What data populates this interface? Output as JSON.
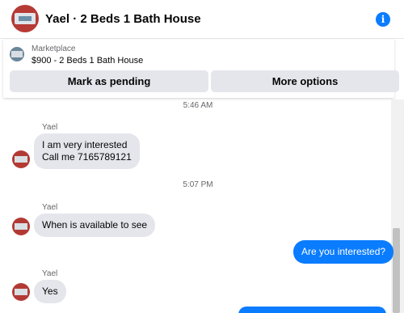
{
  "header": {
    "title": "Yael · 2 Beds 1 Bath House",
    "info_icon": "i"
  },
  "listing": {
    "kicker": "Marketplace",
    "title": "$900 - 2 Beds 1 Bath House",
    "buttons": {
      "pending": "Mark as pending",
      "more": "More options"
    }
  },
  "chat": {
    "timestamps": [
      "5:46 AM",
      "5:07 PM"
    ],
    "groups": [
      {
        "sender": "Yael",
        "lines": [
          "I am very interested",
          "Call me 7165789121"
        ]
      },
      {
        "sender": "Yael",
        "lines": [
          "When is available to see"
        ]
      },
      {
        "sender": "Yael",
        "lines": [
          "Yes"
        ]
      }
    ],
    "outgoing": [
      "Are you interested?"
    ]
  },
  "colors": {
    "accent": "#0a7cff",
    "bubble_in": "#e4e6eb",
    "button_bg": "#e4e6eb"
  }
}
